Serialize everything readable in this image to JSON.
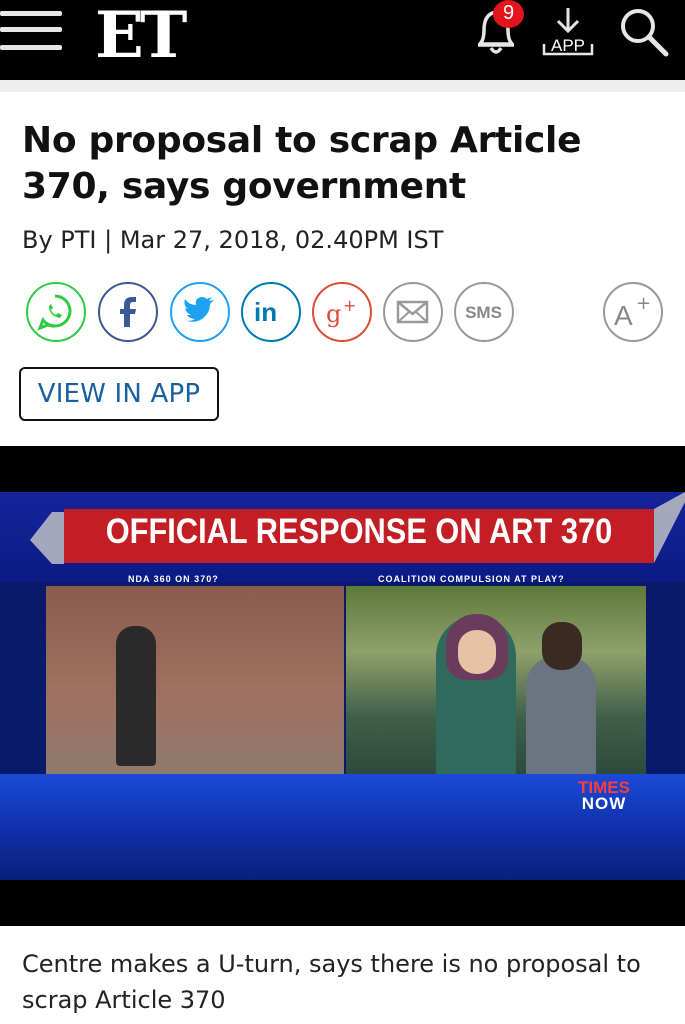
{
  "header": {
    "logo": "ET",
    "notification_count": "9",
    "app_label": "APP",
    "icons": [
      "menu-icon",
      "bell-icon",
      "download-app-icon",
      "search-icon"
    ]
  },
  "article": {
    "headline": "No proposal to scrap Article 370, says government",
    "byline": "By PTI | Mar 27, 2018, 02.40PM IST",
    "share": {
      "icons": [
        "whatsapp-icon",
        "facebook-icon",
        "twitter-icon",
        "linkedin-icon",
        "googleplus-icon",
        "email-icon",
        "sms-icon",
        "font-size-icon"
      ],
      "sms_label": "SMS",
      "font_label": "A"
    },
    "view_in_app": "VIEW IN APP"
  },
  "video": {
    "banner_title": "OFFICIAL RESPONSE ON ART 370",
    "sub_left": "NDA 360 ON 370?",
    "sub_right": "COALITION COMPULSION AT PLAY?",
    "channel_top": "TIMES",
    "channel_bottom": "NOW"
  },
  "caption": "Centre makes a U-turn, says there is no proposal to scrap Article 370",
  "colors": {
    "topbar": "#000000",
    "badge": "#e3141b",
    "link_blue": "#1a5fa0",
    "whatsapp": "#2ecc40",
    "facebook": "#3b5998",
    "twitter": "#1da1f2",
    "linkedin": "#0077b5",
    "googleplus": "#dd4b39",
    "banner_red": "#c21e24"
  }
}
